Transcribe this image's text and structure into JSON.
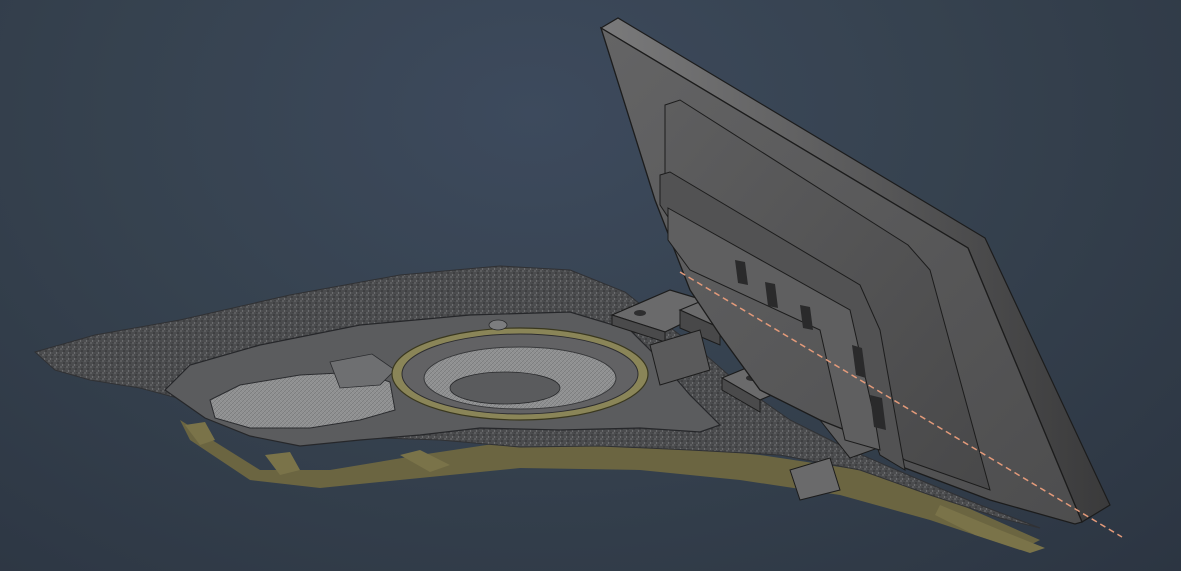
{
  "viewport": {
    "background_top": "#3d4a5d",
    "background_bottom": "#2c3542"
  },
  "model": {
    "scan_surface_color": "#4a4b4d",
    "scan_edge_color": "#6f6a44",
    "speaker_ring_color": "#8a8558",
    "cad_panel_color": "#5a5a5b",
    "cad_edge_color": "#1c1c1c",
    "axis_line_color": "#e39a7a"
  }
}
